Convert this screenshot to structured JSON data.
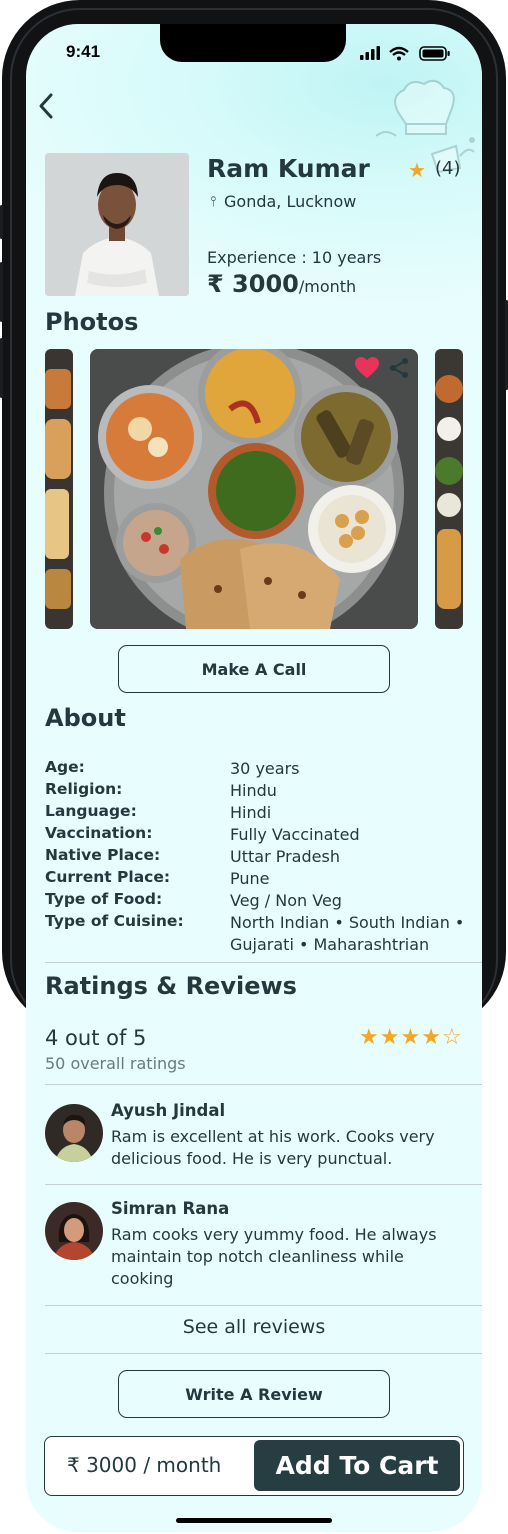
{
  "status_bar": {
    "time": "9:41"
  },
  "profile": {
    "name": "Ram Kumar",
    "rating_count": "(4)",
    "location": "Gonda, Lucknow",
    "experience": "Experience : 10 years",
    "price_amount": "₹ 3000",
    "price_period": "/month"
  },
  "photos": {
    "title": "Photos"
  },
  "actions": {
    "call_label": "Make A Call",
    "review_label": "Write A Review"
  },
  "about": {
    "title": "About",
    "rows": [
      {
        "label": "Age:",
        "value": "30 years"
      },
      {
        "label": "Religion:",
        "value": "Hindu"
      },
      {
        "label": "Language:",
        "value": "Hindi"
      },
      {
        "label": "Vaccination:",
        "value": "Fully Vaccinated"
      },
      {
        "label": "Native Place:",
        "value": "Uttar Pradesh"
      },
      {
        "label": "Current Place:",
        "value": "Pune"
      },
      {
        "label": "Type of Food:",
        "value": "Veg / Non Veg"
      },
      {
        "label": "Type of Cuisine:",
        "value": "North Indian • South Indian • Gujarati • Maharashtrian"
      }
    ]
  },
  "ratings": {
    "title": "Ratings & Reviews",
    "score_text": "4 out of 5",
    "count_text": "50 overall ratings",
    "stars_filled": 4,
    "stars_total": 5,
    "star_color": "#f5a623",
    "see_all": "See all reviews",
    "reviews": [
      {
        "name": "Ayush Jindal",
        "text": "Ram is excellent at his work. Cooks very delicious food. He is very punctual."
      },
      {
        "name": "Simran Rana",
        "text": "Ram cooks very yummy food. He always maintain top notch cleanliness while cooking"
      }
    ]
  },
  "cart": {
    "price": "₹ 3000 / month",
    "button": "Add To Cart",
    "button_color": "#263d42"
  },
  "icons": [
    "back-arrow-icon",
    "star-icon",
    "location-pin-icon",
    "heart-icon",
    "share-icon"
  ],
  "colors": {
    "background": "#e8fdfd",
    "text": "#23393d",
    "accent_heart": "#e9335a"
  }
}
